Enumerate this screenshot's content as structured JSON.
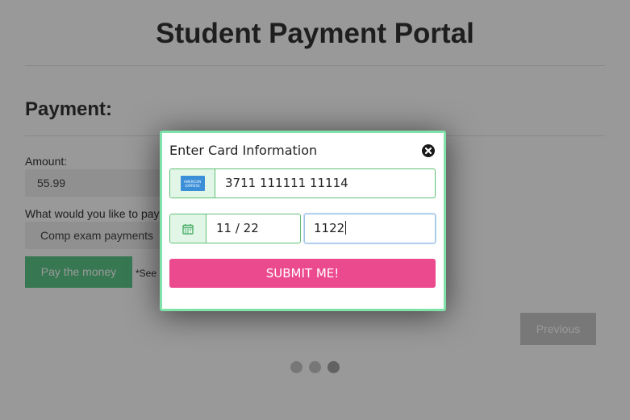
{
  "page": {
    "title": "Student Payment Portal",
    "section_title": "Payment:",
    "amount_label": "Amount:",
    "amount_value": "55.99",
    "purpose_label": "What would you like to pay",
    "purpose_value": "Comp exam payments",
    "pay_button": "Pay the money",
    "note": "*See",
    "previous_button": "Previous",
    "step_dots": 3,
    "active_step": 3
  },
  "modal": {
    "title": "Enter Card Information",
    "card_number": "3711 111111 11114",
    "card_brand": "amex-card-icon",
    "expiry": "11 / 22",
    "cvc": "1122",
    "submit_label": "SUBMIT ME!",
    "close_icon": "close-icon",
    "calendar_icon": "calendar-icon"
  },
  "colors": {
    "accent_green": "#5cc98a",
    "modal_border": "#7fe2a8",
    "submit_pink": "#ec4a8f",
    "overlay": "rgba(0,0,0,0.40)"
  }
}
